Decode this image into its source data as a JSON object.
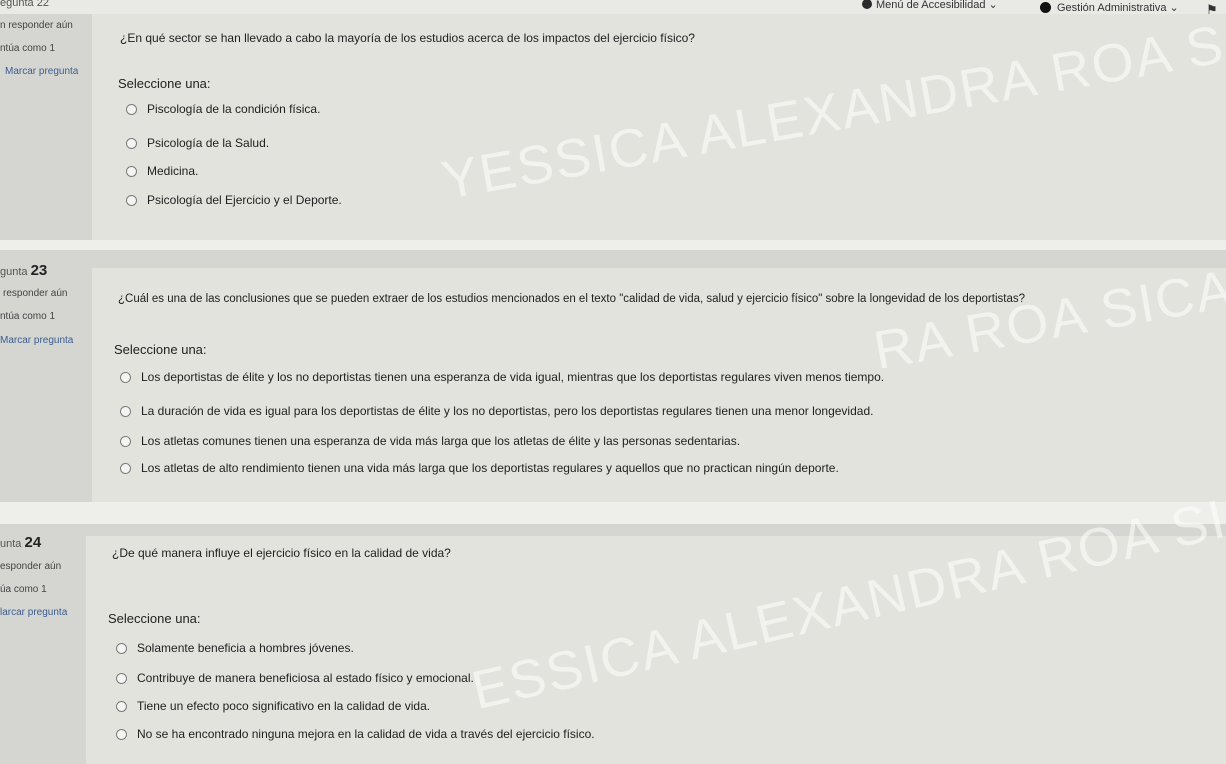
{
  "topbar": {
    "crumb": "egunta 22",
    "accessibility_menu": "Menú de Accesibilidad ⌄",
    "user_menu": "Gestión Administrativa ⌄"
  },
  "questions": [
    {
      "number_prefix": "",
      "number": "",
      "status": "n responder aún",
      "points": "ntúa como 1",
      "flag": "Marcar pregunta",
      "text": "¿En qué sector se han llevado a cabo la mayoría de los estudios acerca de los impactos del ejercicio físico?",
      "select_label": "Seleccione una:",
      "options": [
        "Piscología de la condición física.",
        "Psicología de la Salud.",
        "Medicina.",
        "Psicología del Ejercicio y el Deporte."
      ]
    },
    {
      "number_prefix": "gunta",
      "number": "23",
      "status": "responder aún",
      "points": "ntúa como 1",
      "flag": "Marcar pregunta",
      "text": "¿Cuál es una de las conclusiones que se pueden extraer de los estudios mencionados en el texto \"calidad de vida, salud y ejercicio físico\" sobre la longevidad de los deportistas?",
      "select_label": "Seleccione una:",
      "options": [
        "Los deportistas de élite y los no deportistas tienen una esperanza de vida igual, mientras que los deportistas regulares viven menos tiempo.",
        "La duración de vida es igual para los deportistas de élite y los no deportistas, pero los deportistas regulares tienen una menor longevidad.",
        "Los atletas comunes tienen una esperanza de vida más larga que los atletas de élite y las personas sedentarias.",
        "Los atletas de alto rendimiento tienen una vida más larga que los deportistas regulares y aquellos que no practican ningún deporte."
      ]
    },
    {
      "number_prefix": "unta",
      "number": "24",
      "status": "esponder aún",
      "points": "úa como 1",
      "flag": "larcar pregunta",
      "text": "¿De qué manera influye el ejercicio físico en la calidad de vida?",
      "select_label": "Seleccione una:",
      "options": [
        "Solamente beneficia a hombres jóvenes.",
        "Contribuye de manera beneficiosa al estado físico y emocional.",
        "Tiene un efecto poco significativo en la calidad de vida.",
        "No se ha encontrado ninguna mejora en la calidad de vida a través del ejercicio físico."
      ]
    }
  ],
  "watermarks": [
    "YESSICA ALEXANDRA ROA SICAC",
    "RA ROA SICA",
    "ESSICA ALEXANDRA ROA SICA"
  ]
}
